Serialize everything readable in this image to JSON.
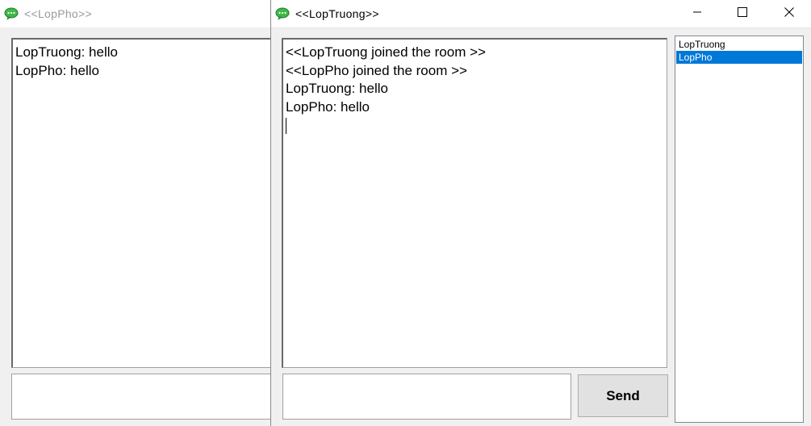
{
  "back_window": {
    "title": "<<LopPho>>",
    "chat_lines": [
      "LopTruong: hello",
      "LopPho: hello"
    ],
    "message_input_value": ""
  },
  "front_window": {
    "title": "<<LopTruong>>",
    "chat_lines": [
      "<<LopTruong joined the room >>",
      "<<LopPho joined the room >>",
      "LopTruong: hello",
      "LopPho: hello"
    ],
    "users": [
      {
        "name": "LopTruong",
        "selected": false
      },
      {
        "name": "LopPho",
        "selected": true
      }
    ],
    "message_input_value": "",
    "send_label": "Send",
    "controls": {
      "minimize": "minimize-icon",
      "maximize": "maximize-icon",
      "close": "close-icon"
    }
  },
  "colors": {
    "selection": "#0078d7",
    "window_bg": "#f0f0f0",
    "icon_green": "#3fb847"
  }
}
